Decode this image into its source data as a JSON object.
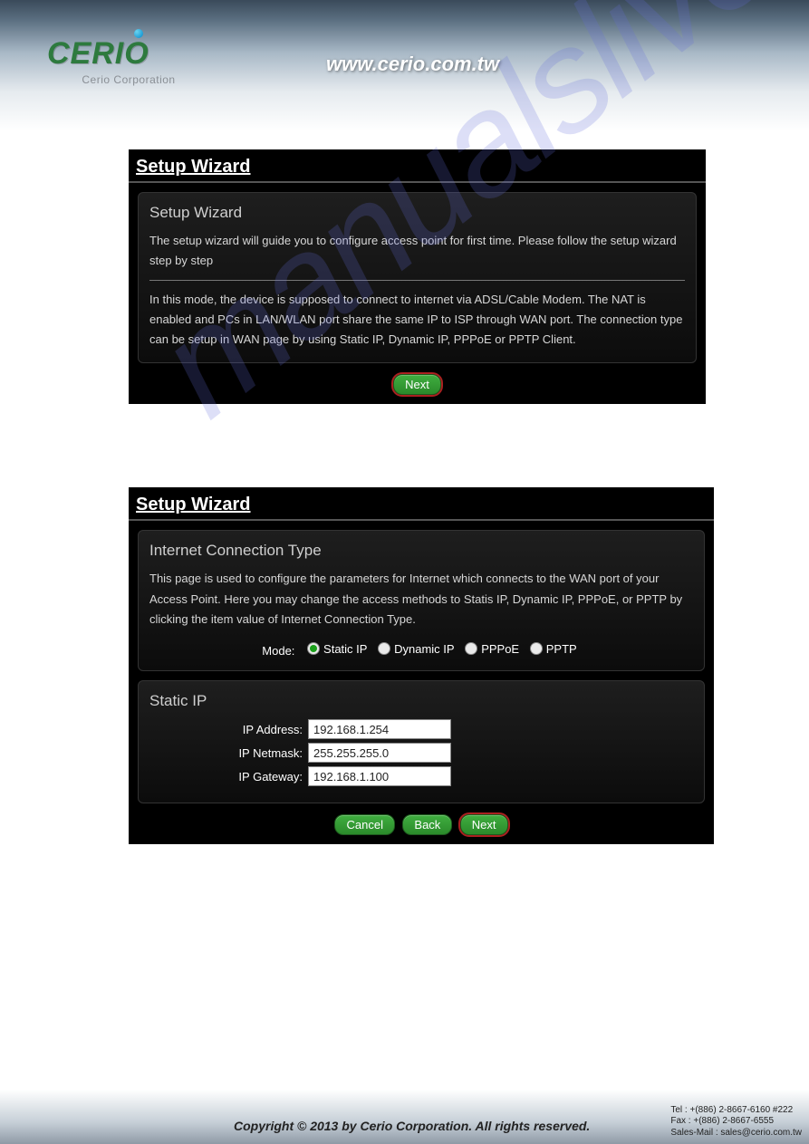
{
  "header": {
    "logo_text": "CERIO",
    "logo_tagline": "Cerio Corporation",
    "url": "www.cerio.com.tw"
  },
  "watermark": "manualslive.com",
  "panel1": {
    "title": "Setup Wizard",
    "heading": "Setup Wizard",
    "intro": "The setup wizard will guide you to configure access point for first time. Please follow the setup wizard step by step",
    "body": "In this mode, the device is supposed to connect to internet via ADSL/Cable Modem. The NAT is enabled and PCs in LAN/WLAN port share the same IP to ISP through WAN port. The connection type can be setup in WAN page by using Static IP, Dynamic IP, PPPoE or PPTP Client.",
    "next_label": "Next"
  },
  "panel2": {
    "title": "Setup Wizard",
    "heading": "Internet Connection Type",
    "intro": "This page is used to configure the parameters for Internet which connects to the WAN port of your Access Point. Here you may change the access methods to Statis IP, Dynamic IP, PPPoE, or PPTP by clicking the item value of Internet Connection Type.",
    "mode_label": "Mode:",
    "modes": {
      "static": "Static IP",
      "dynamic": "Dynamic IP",
      "pppoe": "PPPoE",
      "pptp": "PPTP"
    },
    "static_heading": "Static IP",
    "fields": {
      "ip_address_label": "IP Address:",
      "ip_address_value": "192.168.1.254",
      "ip_netmask_label": "IP Netmask:",
      "ip_netmask_value": "255.255.255.0",
      "ip_gateway_label": "IP Gateway:",
      "ip_gateway_value": "192.168.1.100"
    },
    "cancel_label": "Cancel",
    "back_label": "Back",
    "next_label": "Next"
  },
  "footer": {
    "copyright": "Copyright © 2013 by Cerio Corporation. All rights reserved.",
    "tel": "Tel : +(886) 2-8667-6160 #222",
    "fax": "Fax : +(886) 2-8667-6555",
    "mail": "Sales-Mail : sales@cerio.com.tw"
  }
}
